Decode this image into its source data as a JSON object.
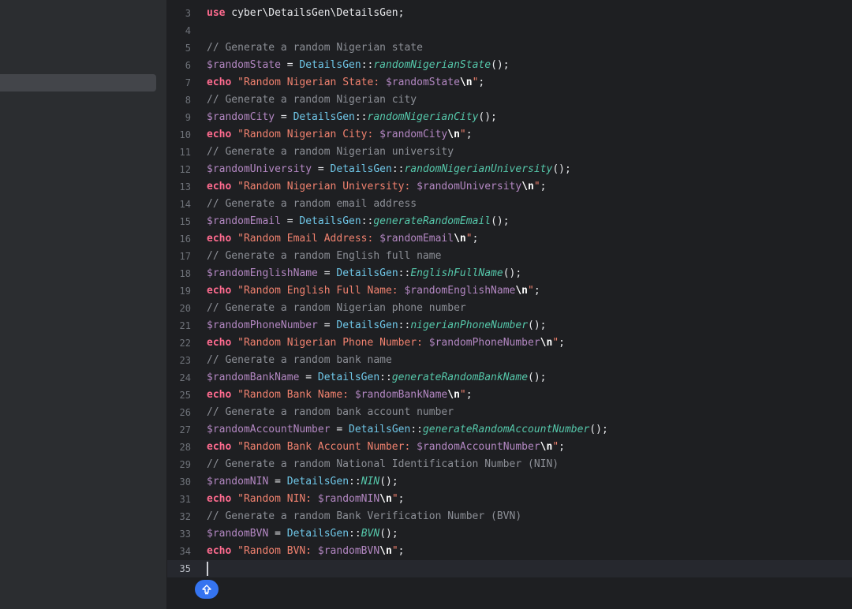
{
  "sidebar": {
    "selected_item": ""
  },
  "editor": {
    "cursor_line": "35",
    "lines": [
      {
        "num": "3",
        "parts": [
          [
            "kw",
            "use"
          ],
          [
            "def",
            " cyber\\DetailsGen\\DetailsGen;"
          ]
        ]
      },
      {
        "num": "4",
        "parts": []
      },
      {
        "num": "5",
        "parts": [
          [
            "cm",
            "// Generate a random Nigerian state"
          ]
        ]
      },
      {
        "num": "6",
        "parts": [
          [
            "var",
            "$randomState"
          ],
          [
            "def",
            " = "
          ],
          [
            "cls",
            "DetailsGen"
          ],
          [
            "def",
            "::"
          ],
          [
            "fn",
            "randomNigerianState"
          ],
          [
            "def",
            "();"
          ]
        ]
      },
      {
        "num": "7",
        "parts": [
          [
            "kw",
            "echo"
          ],
          [
            "def",
            " "
          ],
          [
            "str",
            "\"Random Nigerian State: "
          ],
          [
            "var",
            "$randomState"
          ],
          [
            "esc",
            "\\n"
          ],
          [
            "str",
            "\""
          ],
          [
            "def",
            ";"
          ]
        ]
      },
      {
        "num": "8",
        "parts": [
          [
            "cm",
            "// Generate a random Nigerian city"
          ]
        ]
      },
      {
        "num": "9",
        "parts": [
          [
            "var",
            "$randomCity"
          ],
          [
            "def",
            " = "
          ],
          [
            "cls",
            "DetailsGen"
          ],
          [
            "def",
            "::"
          ],
          [
            "fn",
            "randomNigerianCity"
          ],
          [
            "def",
            "();"
          ]
        ]
      },
      {
        "num": "10",
        "parts": [
          [
            "kw",
            "echo"
          ],
          [
            "def",
            " "
          ],
          [
            "str",
            "\"Random Nigerian City: "
          ],
          [
            "var",
            "$randomCity"
          ],
          [
            "esc",
            "\\n"
          ],
          [
            "str",
            "\""
          ],
          [
            "def",
            ";"
          ]
        ]
      },
      {
        "num": "11",
        "parts": [
          [
            "cm",
            "// Generate a random Nigerian university"
          ]
        ]
      },
      {
        "num": "12",
        "parts": [
          [
            "var",
            "$randomUniversity"
          ],
          [
            "def",
            " = "
          ],
          [
            "cls",
            "DetailsGen"
          ],
          [
            "def",
            "::"
          ],
          [
            "fn",
            "randomNigerianUniversity"
          ],
          [
            "def",
            "();"
          ]
        ]
      },
      {
        "num": "13",
        "parts": [
          [
            "kw",
            "echo"
          ],
          [
            "def",
            " "
          ],
          [
            "str",
            "\"Random Nigerian University: "
          ],
          [
            "var",
            "$randomUniversity"
          ],
          [
            "esc",
            "\\n"
          ],
          [
            "str",
            "\""
          ],
          [
            "def",
            ";"
          ]
        ]
      },
      {
        "num": "14",
        "parts": [
          [
            "cm",
            "// Generate a random email address"
          ]
        ]
      },
      {
        "num": "15",
        "parts": [
          [
            "var",
            "$randomEmail"
          ],
          [
            "def",
            " = "
          ],
          [
            "cls",
            "DetailsGen"
          ],
          [
            "def",
            "::"
          ],
          [
            "fn",
            "generateRandomEmail"
          ],
          [
            "def",
            "();"
          ]
        ]
      },
      {
        "num": "16",
        "parts": [
          [
            "kw",
            "echo"
          ],
          [
            "def",
            " "
          ],
          [
            "str",
            "\"Random Email Address: "
          ],
          [
            "var",
            "$randomEmail"
          ],
          [
            "esc",
            "\\n"
          ],
          [
            "str",
            "\""
          ],
          [
            "def",
            ";"
          ]
        ]
      },
      {
        "num": "17",
        "parts": [
          [
            "cm",
            "// Generate a random English full name"
          ]
        ]
      },
      {
        "num": "18",
        "parts": [
          [
            "var",
            "$randomEnglishName"
          ],
          [
            "def",
            " = "
          ],
          [
            "cls",
            "DetailsGen"
          ],
          [
            "def",
            "::"
          ],
          [
            "fn",
            "EnglishFullName"
          ],
          [
            "def",
            "();"
          ]
        ]
      },
      {
        "num": "19",
        "parts": [
          [
            "kw",
            "echo"
          ],
          [
            "def",
            " "
          ],
          [
            "str",
            "\"Random English Full Name: "
          ],
          [
            "var",
            "$randomEnglishName"
          ],
          [
            "esc",
            "\\n"
          ],
          [
            "str",
            "\""
          ],
          [
            "def",
            ";"
          ]
        ]
      },
      {
        "num": "20",
        "parts": [
          [
            "cm",
            "// Generate a random Nigerian phone number"
          ]
        ]
      },
      {
        "num": "21",
        "parts": [
          [
            "var",
            "$randomPhoneNumber"
          ],
          [
            "def",
            " = "
          ],
          [
            "cls",
            "DetailsGen"
          ],
          [
            "def",
            "::"
          ],
          [
            "fn",
            "nigerianPhoneNumber"
          ],
          [
            "def",
            "();"
          ]
        ]
      },
      {
        "num": "22",
        "parts": [
          [
            "kw",
            "echo"
          ],
          [
            "def",
            " "
          ],
          [
            "str",
            "\"Random Nigerian Phone Number: "
          ],
          [
            "var",
            "$randomPhoneNumber"
          ],
          [
            "esc",
            "\\n"
          ],
          [
            "str",
            "\""
          ],
          [
            "def",
            ";"
          ]
        ]
      },
      {
        "num": "23",
        "parts": [
          [
            "cm",
            "// Generate a random bank name"
          ]
        ]
      },
      {
        "num": "24",
        "parts": [
          [
            "var",
            "$randomBankName"
          ],
          [
            "def",
            " = "
          ],
          [
            "cls",
            "DetailsGen"
          ],
          [
            "def",
            "::"
          ],
          [
            "fn",
            "generateRandomBankName"
          ],
          [
            "def",
            "();"
          ]
        ]
      },
      {
        "num": "25",
        "parts": [
          [
            "kw",
            "echo"
          ],
          [
            "def",
            " "
          ],
          [
            "str",
            "\"Random Bank Name: "
          ],
          [
            "var",
            "$randomBankName"
          ],
          [
            "esc",
            "\\n"
          ],
          [
            "str",
            "\""
          ],
          [
            "def",
            ";"
          ]
        ]
      },
      {
        "num": "26",
        "parts": [
          [
            "cm",
            "// Generate a random bank account number"
          ]
        ]
      },
      {
        "num": "27",
        "parts": [
          [
            "var",
            "$randomAccountNumber"
          ],
          [
            "def",
            " = "
          ],
          [
            "cls",
            "DetailsGen"
          ],
          [
            "def",
            "::"
          ],
          [
            "fn",
            "generateRandomAccountNumber"
          ],
          [
            "def",
            "();"
          ]
        ]
      },
      {
        "num": "28",
        "parts": [
          [
            "kw",
            "echo"
          ],
          [
            "def",
            " "
          ],
          [
            "str",
            "\"Random Bank Account Number: "
          ],
          [
            "var",
            "$randomAccountNumber"
          ],
          [
            "esc",
            "\\n"
          ],
          [
            "str",
            "\""
          ],
          [
            "def",
            ";"
          ]
        ]
      },
      {
        "num": "29",
        "parts": [
          [
            "cm",
            "// Generate a random National Identification Number (NIN)"
          ]
        ]
      },
      {
        "num": "30",
        "parts": [
          [
            "var",
            "$randomNIN"
          ],
          [
            "def",
            " = "
          ],
          [
            "cls",
            "DetailsGen"
          ],
          [
            "def",
            "::"
          ],
          [
            "fn",
            "NIN"
          ],
          [
            "def",
            "();"
          ]
        ]
      },
      {
        "num": "31",
        "parts": [
          [
            "kw",
            "echo"
          ],
          [
            "def",
            " "
          ],
          [
            "str",
            "\"Random NIN: "
          ],
          [
            "var",
            "$randomNIN"
          ],
          [
            "esc",
            "\\n"
          ],
          [
            "str",
            "\""
          ],
          [
            "def",
            ";"
          ]
        ]
      },
      {
        "num": "32",
        "parts": [
          [
            "cm",
            "// Generate a random Bank Verification Number (BVN)"
          ]
        ]
      },
      {
        "num": "33",
        "parts": [
          [
            "var",
            "$randomBVN"
          ],
          [
            "def",
            " = "
          ],
          [
            "cls",
            "DetailsGen"
          ],
          [
            "def",
            "::"
          ],
          [
            "fn",
            "BVN"
          ],
          [
            "def",
            "();"
          ]
        ]
      },
      {
        "num": "34",
        "parts": [
          [
            "kw",
            "echo"
          ],
          [
            "def",
            " "
          ],
          [
            "str",
            "\"Random BVN: "
          ],
          [
            "var",
            "$randomBVN"
          ],
          [
            "esc",
            "\\n"
          ],
          [
            "str",
            "\""
          ],
          [
            "def",
            ";"
          ]
        ]
      },
      {
        "num": "35",
        "parts": []
      }
    ]
  },
  "icons": {
    "fab": "arrow-up-icon"
  }
}
